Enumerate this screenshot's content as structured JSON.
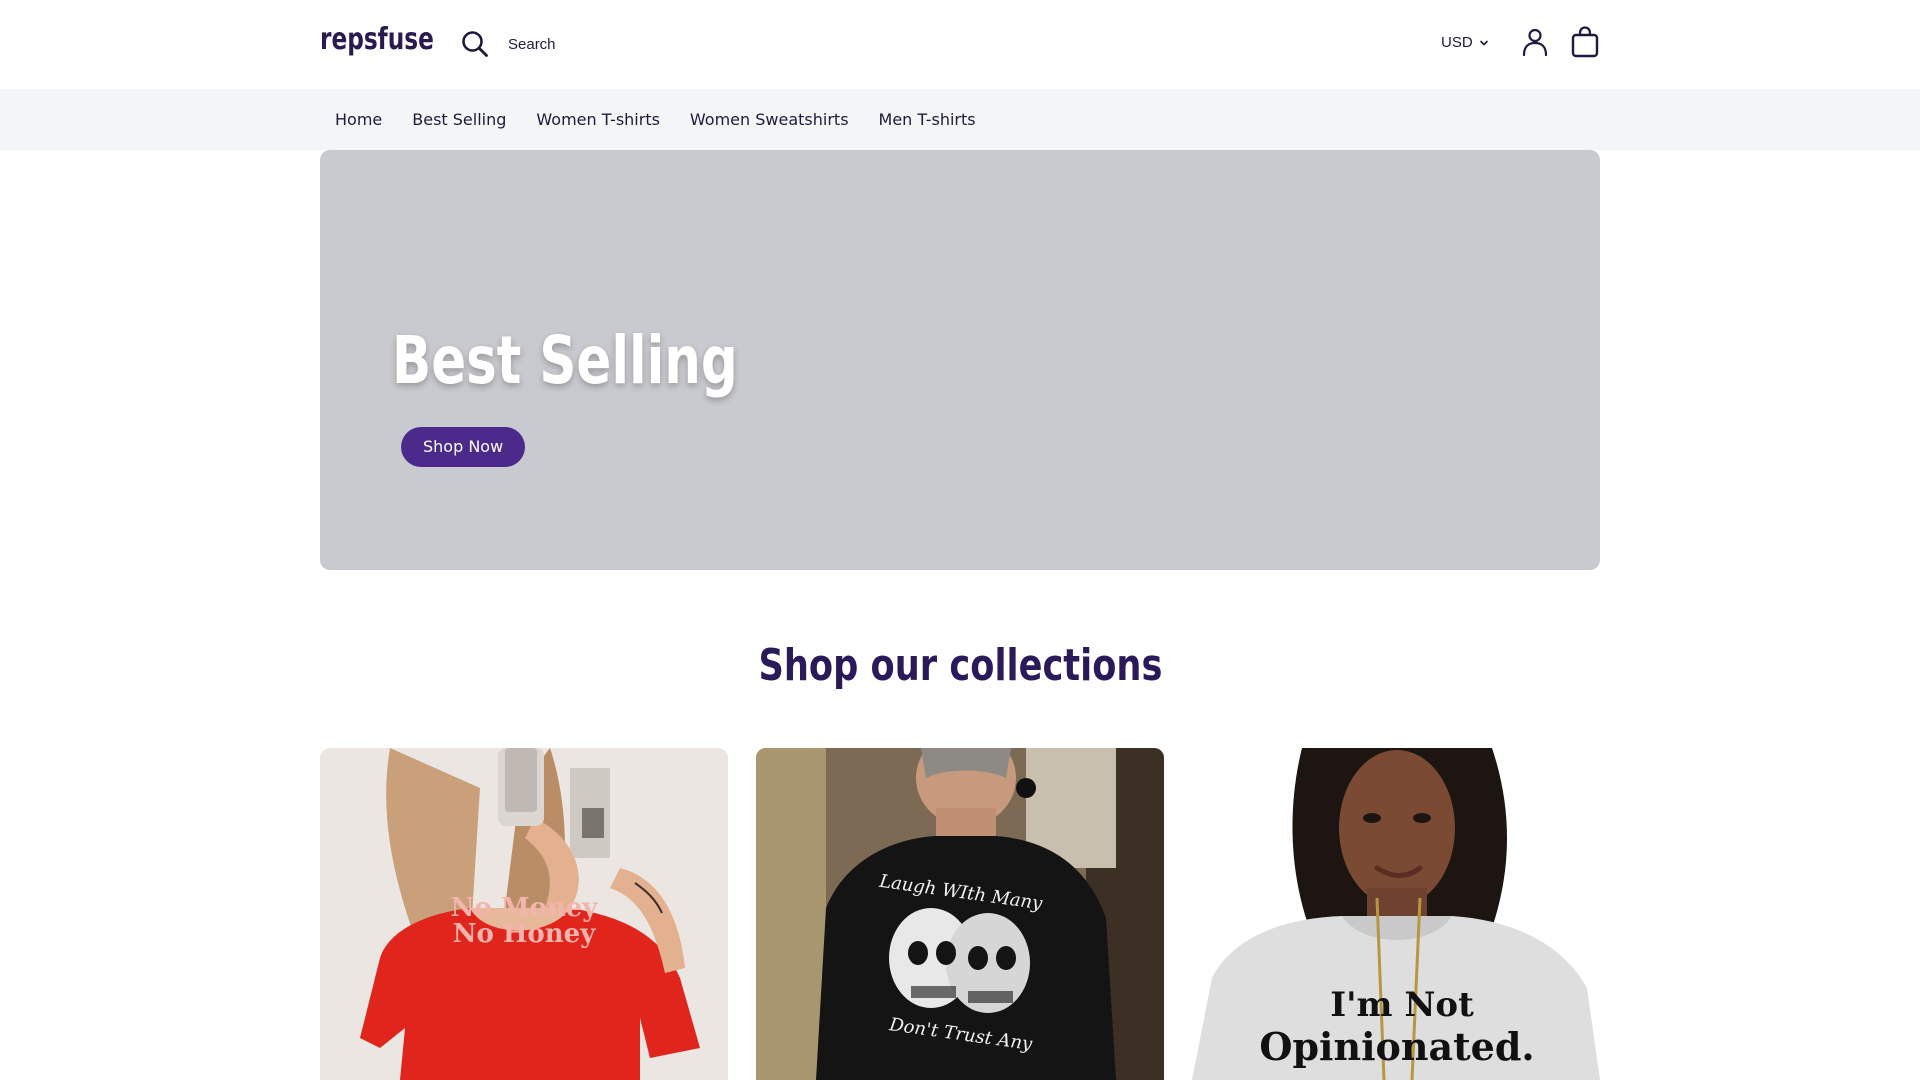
{
  "header": {
    "logo": "repsfuse",
    "search_label": "Search",
    "currency": "USD"
  },
  "nav": {
    "items": [
      {
        "label": "Home"
      },
      {
        "label": "Best Selling"
      },
      {
        "label": "Women T-shirts"
      },
      {
        "label": "Women Sweatshirts"
      },
      {
        "label": "Men T-shirts"
      }
    ]
  },
  "hero": {
    "title": "Best Selling",
    "button_label": "Shop Now"
  },
  "collections": {
    "title": "Shop our collections",
    "cards": [
      {
        "image_text": [
          "No Money",
          "No Honey"
        ]
      },
      {
        "image_text": [
          "Laugh WIth Many",
          "Don't Trust Any"
        ]
      },
      {
        "image_text": [
          "I'm Not",
          "Opinionated."
        ]
      }
    ]
  },
  "colors": {
    "brand_purple": "#4b2a8c",
    "heading": "#2a1a5a",
    "hero_bg": "#c9cacf",
    "nav_bg": "#f4f5f7"
  }
}
